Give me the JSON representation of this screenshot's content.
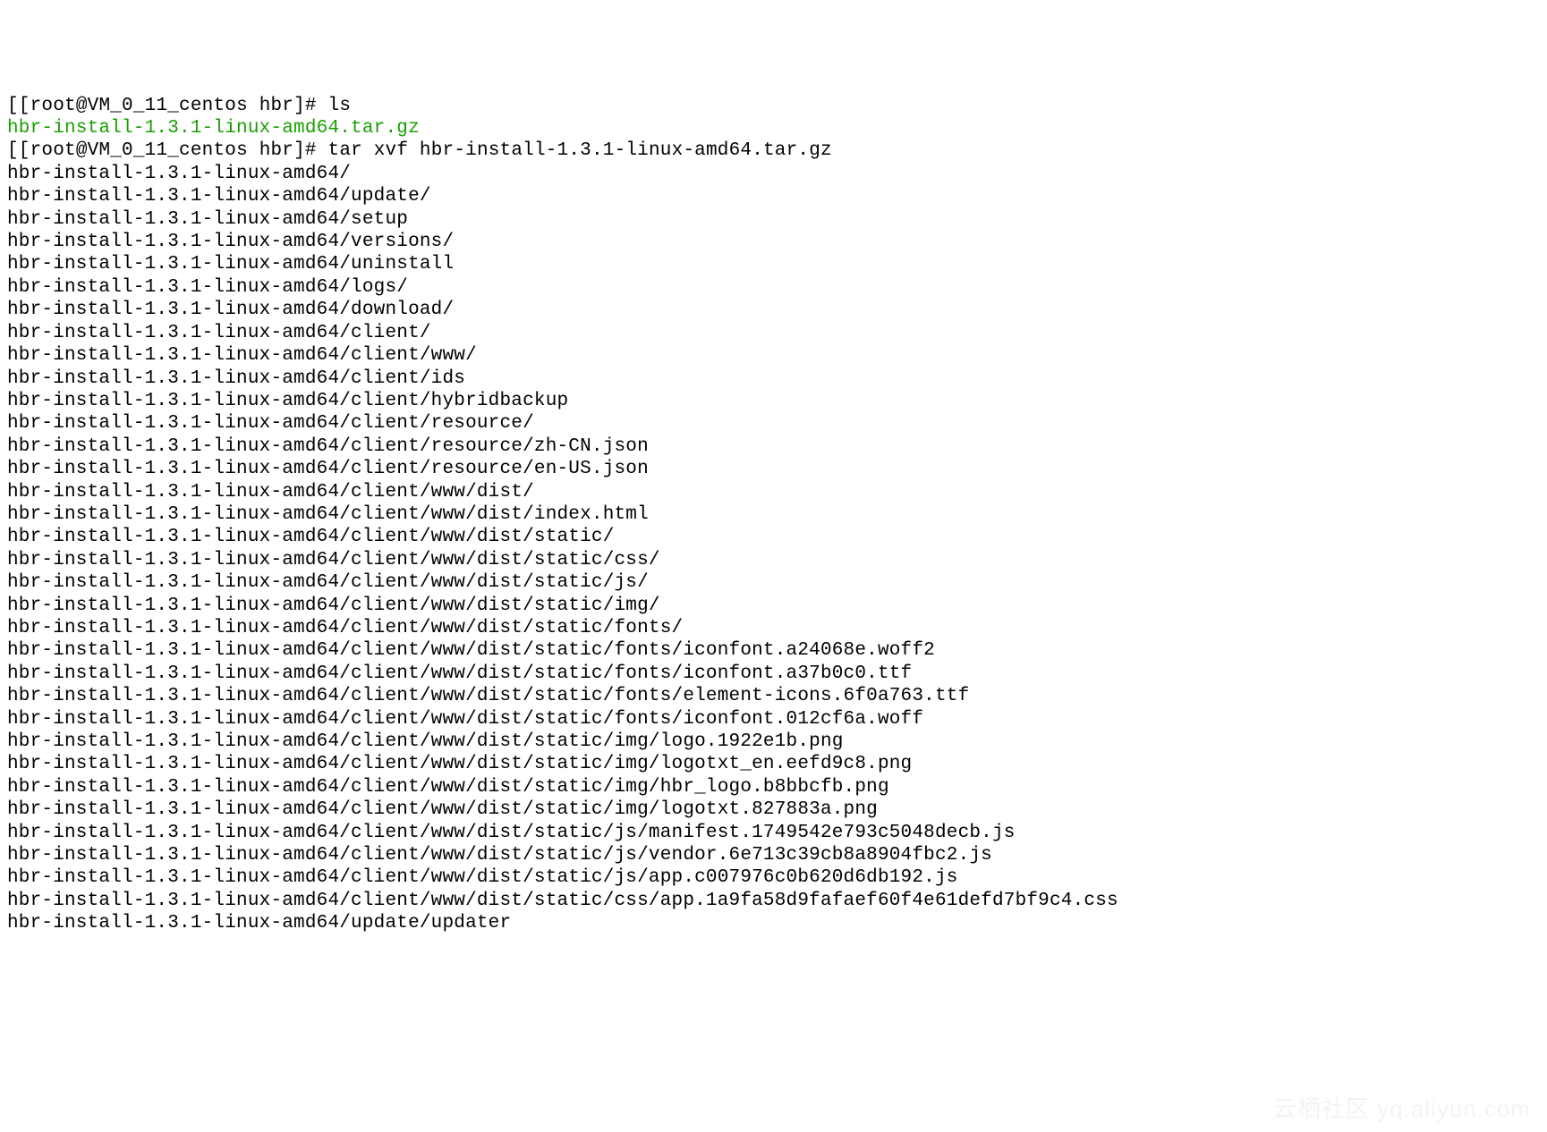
{
  "prompt1": {
    "open": "[[",
    "user": "root",
    "at": "@",
    "host": "VM_0_11_centos",
    "cwd": "hbr",
    "close": "]#",
    "command": "ls"
  },
  "ls_output": {
    "file": "hbr-install-1.3.1-linux-amd64.tar.gz"
  },
  "prompt2": {
    "open": "[[",
    "user": "root",
    "at": "@",
    "host": "VM_0_11_centos",
    "cwd": "hbr",
    "close": "]#",
    "command": "tar xvf hbr-install-1.3.1-linux-amd64.tar.gz"
  },
  "tar_output": [
    "hbr-install-1.3.1-linux-amd64/",
    "hbr-install-1.3.1-linux-amd64/update/",
    "hbr-install-1.3.1-linux-amd64/setup",
    "hbr-install-1.3.1-linux-amd64/versions/",
    "hbr-install-1.3.1-linux-amd64/uninstall",
    "hbr-install-1.3.1-linux-amd64/logs/",
    "hbr-install-1.3.1-linux-amd64/download/",
    "hbr-install-1.3.1-linux-amd64/client/",
    "hbr-install-1.3.1-linux-amd64/client/www/",
    "hbr-install-1.3.1-linux-amd64/client/ids",
    "hbr-install-1.3.1-linux-amd64/client/hybridbackup",
    "hbr-install-1.3.1-linux-amd64/client/resource/",
    "hbr-install-1.3.1-linux-amd64/client/resource/zh-CN.json",
    "hbr-install-1.3.1-linux-amd64/client/resource/en-US.json",
    "hbr-install-1.3.1-linux-amd64/client/www/dist/",
    "hbr-install-1.3.1-linux-amd64/client/www/dist/index.html",
    "hbr-install-1.3.1-linux-amd64/client/www/dist/static/",
    "hbr-install-1.3.1-linux-amd64/client/www/dist/static/css/",
    "hbr-install-1.3.1-linux-amd64/client/www/dist/static/js/",
    "hbr-install-1.3.1-linux-amd64/client/www/dist/static/img/",
    "hbr-install-1.3.1-linux-amd64/client/www/dist/static/fonts/",
    "hbr-install-1.3.1-linux-amd64/client/www/dist/static/fonts/iconfont.a24068e.woff2",
    "hbr-install-1.3.1-linux-amd64/client/www/dist/static/fonts/iconfont.a37b0c0.ttf",
    "hbr-install-1.3.1-linux-amd64/client/www/dist/static/fonts/element-icons.6f0a763.ttf",
    "hbr-install-1.3.1-linux-amd64/client/www/dist/static/fonts/iconfont.012cf6a.woff",
    "hbr-install-1.3.1-linux-amd64/client/www/dist/static/img/logo.1922e1b.png",
    "hbr-install-1.3.1-linux-amd64/client/www/dist/static/img/logotxt_en.eefd9c8.png",
    "hbr-install-1.3.1-linux-amd64/client/www/dist/static/img/hbr_logo.b8bbcfb.png",
    "hbr-install-1.3.1-linux-amd64/client/www/dist/static/img/logotxt.827883a.png",
    "hbr-install-1.3.1-linux-amd64/client/www/dist/static/js/manifest.1749542e793c5048decb.js",
    "hbr-install-1.3.1-linux-amd64/client/www/dist/static/js/vendor.6e713c39cb8a8904fbc2.js",
    "hbr-install-1.3.1-linux-amd64/client/www/dist/static/js/app.c007976c0b620d6db192.js",
    "hbr-install-1.3.1-linux-amd64/client/www/dist/static/css/app.1a9fa58d9fafaef60f4e61defd7bf9c4.css",
    "hbr-install-1.3.1-linux-amd64/update/updater"
  ],
  "watermark": "云栖社区 yq.aliyun.com"
}
